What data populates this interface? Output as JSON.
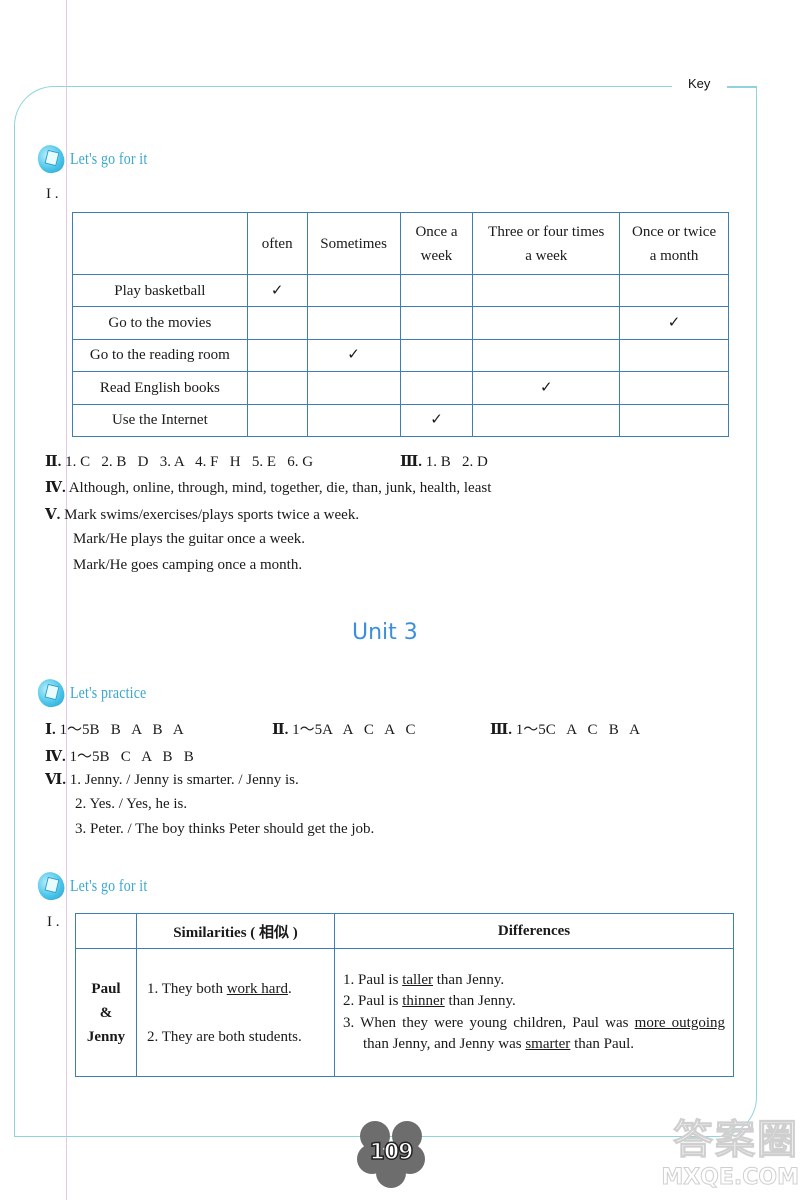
{
  "header": {
    "key_label": "Key"
  },
  "section1": {
    "heading": "Let's go for it",
    "part1_label": "I .",
    "frequency_table": {
      "columns": [
        "",
        "often",
        "Sometimes",
        "Once a week",
        "Three or four times a week",
        "Once or twice a month"
      ],
      "column_lines": [
        [
          ""
        ],
        [
          "often"
        ],
        [
          "Sometimes"
        ],
        [
          "Once a",
          "week"
        ],
        [
          "Three or four times",
          "a week"
        ],
        [
          "Once or twice",
          "a month"
        ]
      ],
      "rows": [
        {
          "activity": "Play basketball",
          "checked_column": "often"
        },
        {
          "activity": "Go to the movies",
          "checked_column": "Once or twice a month"
        },
        {
          "activity": "Go to the reading room",
          "checked_column": "Sometimes"
        },
        {
          "activity": "Read English books",
          "checked_column": "Three or four times a week"
        },
        {
          "activity": "Use the Internet",
          "checked_column": "Once a week"
        }
      ],
      "check_mark": "✓"
    },
    "answers": [
      {
        "label": "Ⅱ.",
        "text": "1. C   2. B   D   3. A   4. F   H   5. E   6. G"
      },
      {
        "label": "Ⅲ.",
        "text": "1. B   2. D"
      },
      {
        "label": "Ⅳ.",
        "text": "Although, online, through, mind, together, die, than, junk, health, least"
      },
      {
        "label": "Ⅴ.",
        "lines": [
          "Mark swims/exercises/plays sports twice a week.",
          "Mark/He plays the guitar once a week.",
          "Mark/He goes camping once a month."
        ]
      }
    ]
  },
  "unit": {
    "title": "Unit 3"
  },
  "section2": {
    "heading": "Let's practice",
    "answers": [
      {
        "label": "Ⅰ.",
        "text": "1～5B   B   A   B   A"
      },
      {
        "label": "Ⅱ.",
        "text": "1～5A   A   C   A   C"
      },
      {
        "label": "Ⅲ.",
        "text": "1～5C   A   C   B   A"
      },
      {
        "label": "Ⅳ.",
        "text": "1～5B   C   A   B   B"
      },
      {
        "label": "Ⅵ.",
        "lines": [
          "1. Jenny. / Jenny is smarter. / Jenny is.",
          "2. Yes. / Yes, he is.",
          "3. Peter. / The boy thinks Peter should get the job."
        ]
      }
    ]
  },
  "section3": {
    "heading": "Let's go for it",
    "part1_label": "I .",
    "comparison_table": {
      "headers": [
        "",
        "Similarities ( 相似 )",
        "Differences"
      ],
      "subject_lines": [
        "Paul",
        "&",
        "Jenny"
      ],
      "similarities": [
        {
          "before": "1. They both ",
          "underlined": "work hard",
          "after": "."
        },
        {
          "before": "2. They are both students.",
          "underlined": "",
          "after": ""
        }
      ],
      "differences": [
        {
          "parts": [
            {
              "t": "1. Paul is "
            },
            {
              "t": "taller",
              "u": true
            },
            {
              "t": " than Jenny."
            }
          ]
        },
        {
          "parts": [
            {
              "t": "2. Paul is "
            },
            {
              "t": "thinner",
              "u": true
            },
            {
              "t": " than Jenny."
            }
          ]
        },
        {
          "parts": [
            {
              "t": "3. When they were young children, Paul was "
            },
            {
              "t": "more outgoing",
              "u": true
            },
            {
              "t": " than Jenny, and Jenny was "
            },
            {
              "t": "smarter",
              "u": true
            },
            {
              "t": " than Paul."
            }
          ]
        }
      ]
    }
  },
  "footer": {
    "page_number": "109"
  },
  "watermark": {
    "line1": "答案圈",
    "line2": "MXQE.COM"
  },
  "colors": {
    "frame": "#8fd4dc",
    "heading": "#3aa7cf",
    "unit_title": "#3b8fdc",
    "table_border": "#3d7fb5"
  }
}
